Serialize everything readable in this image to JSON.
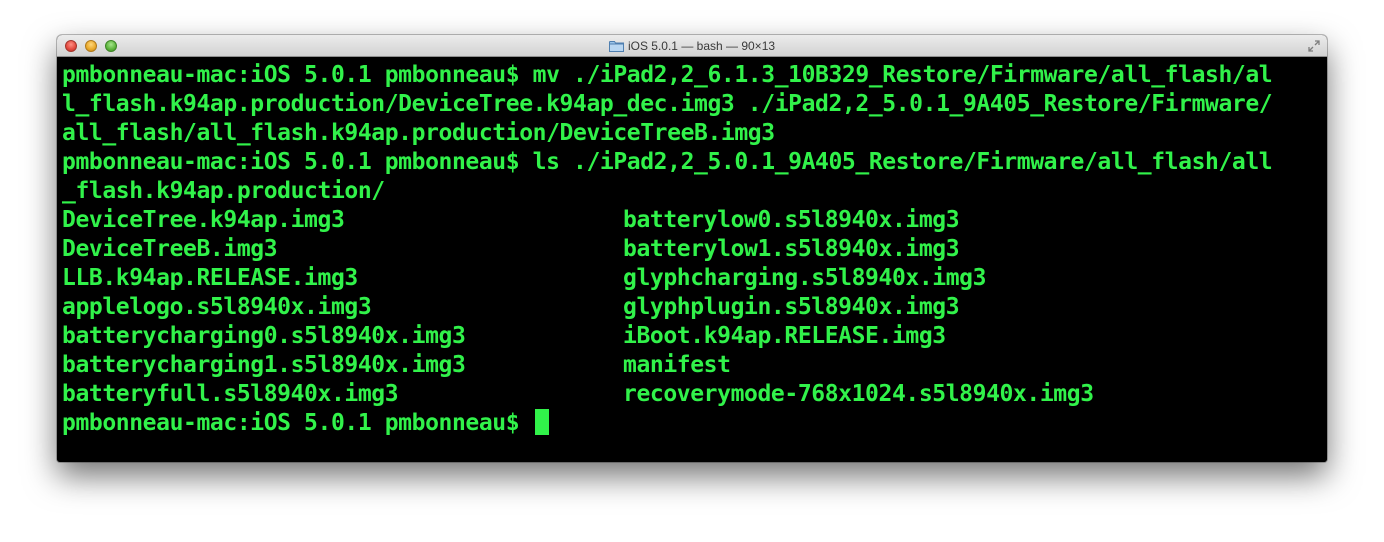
{
  "window": {
    "title": "iOS 5.0.1 — bash — 90×13"
  },
  "terminal": {
    "lines": [
      "pmbonneau-mac:iOS 5.0.1 pmbonneau$ mv ./iPad2,2_6.1.3_10B329_Restore/Firmware/all_flash/al",
      "l_flash.k94ap.production/DeviceTree.k94ap_dec.img3 ./iPad2,2_5.0.1_9A405_Restore/Firmware/",
      "all_flash/all_flash.k94ap.production/DeviceTreeB.img3",
      "pmbonneau-mac:iOS 5.0.1 pmbonneau$ ls ./iPad2,2_5.0.1_9A405_Restore/Firmware/all_flash/all",
      "_flash.k94ap.production/"
    ],
    "files_left": [
      "DeviceTree.k94ap.img3",
      "DeviceTreeB.img3",
      "LLB.k94ap.RELEASE.img3",
      "applelogo.s5l8940x.img3",
      "batterycharging0.s5l8940x.img3",
      "batterycharging1.s5l8940x.img3",
      "batteryfull.s5l8940x.img3"
    ],
    "files_right": [
      "batterylow0.s5l8940x.img3",
      "batterylow1.s5l8940x.img3",
      "glyphcharging.s5l8940x.img3",
      "glyphplugin.s5l8940x.img3",
      "iBoot.k94ap.RELEASE.img3",
      "manifest",
      "recoverymode-768x1024.s5l8940x.img3"
    ],
    "prompt": "pmbonneau-mac:iOS 5.0.1 pmbonneau$ "
  },
  "colors": {
    "text": "#31f24a",
    "background": "#000000"
  },
  "icons": {
    "title_icon": "folder-icon",
    "resize": "fullscreen-icon"
  }
}
